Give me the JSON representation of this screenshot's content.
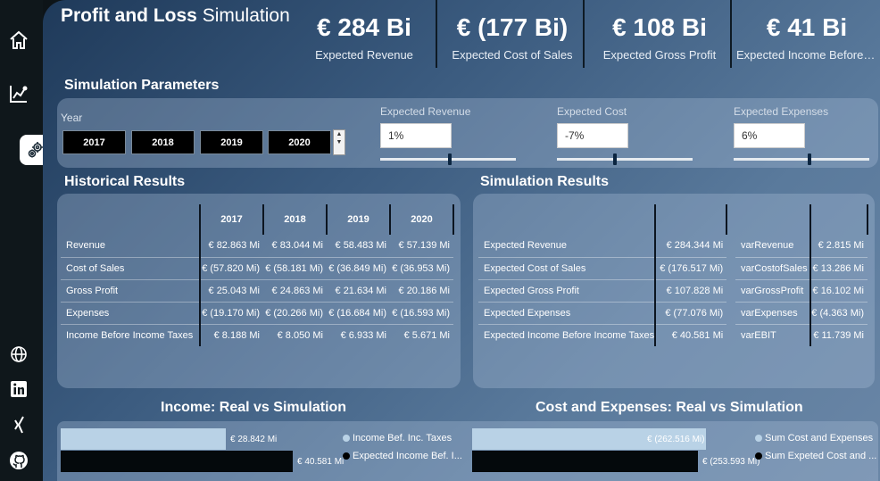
{
  "header": {
    "title_bold": "Profit and Loss",
    "title_light": "Simulation"
  },
  "sidebar": {
    "items": [
      {
        "icon": "home-icon"
      },
      {
        "icon": "line-chart-icon"
      },
      {
        "icon": "gears-icon"
      },
      {
        "icon": "globe-icon"
      },
      {
        "icon": "linkedin-icon"
      },
      {
        "icon": "xing-icon"
      },
      {
        "icon": "github-icon"
      }
    ]
  },
  "kpis": [
    {
      "value": "€ 284 Bi",
      "label": "Expected Revenue"
    },
    {
      "value": "€ (177 Bi)",
      "label": "Expected Cost of Sales"
    },
    {
      "value": "€ 108 Bi",
      "label": "Expected Gross Profit"
    },
    {
      "value": "€ 41 Bi",
      "label": "Expected Income Before Income Taxes"
    }
  ],
  "simulation_parameters": {
    "title": "Simulation Parameters",
    "year_label": "Year",
    "years": [
      "2017",
      "2018",
      "2019",
      "2020"
    ],
    "params": [
      {
        "label": "Expected Revenue",
        "value": "1%",
        "slider_fraction": 0.51
      },
      {
        "label": "Expected Cost",
        "value": "-7%",
        "slider_fraction": 0.43
      },
      {
        "label": "Expected Expenses",
        "value": "6%",
        "slider_fraction": 0.56
      }
    ]
  },
  "historical": {
    "title": "Historical Results",
    "columns": [
      "2017",
      "2018",
      "2019",
      "2020"
    ],
    "rows": [
      {
        "name": "Revenue",
        "values": [
          "€ 82.863 Mi",
          "€ 83.044 Mi",
          "€ 58.483 Mi",
          "€ 57.139 Mi"
        ]
      },
      {
        "name": "Cost of Sales",
        "values": [
          "€ (57.820 Mi)",
          "€ (58.181 Mi)",
          "€ (36.849 Mi)",
          "€ (36.953 Mi)"
        ]
      },
      {
        "name": "Gross Profit",
        "values": [
          "€ 25.043 Mi",
          "€ 24.863 Mi",
          "€ 21.634 Mi",
          "€ 20.186 Mi"
        ]
      },
      {
        "name": "Expenses",
        "values": [
          "€ (19.170 Mi)",
          "€ (20.266 Mi)",
          "€ (16.684 Mi)",
          "€ (16.593 Mi)"
        ]
      },
      {
        "name": "Income Before Income Taxes",
        "values": [
          "€ 8.188 Mi",
          "€ 8.050 Mi",
          "€ 6.933 Mi",
          "€ 5.671 Mi"
        ]
      }
    ]
  },
  "simulation": {
    "title": "Simulation Results",
    "rows": [
      {
        "name": "Expected Revenue",
        "value": "€ 284.344 Mi"
      },
      {
        "name": "Expected Cost of Sales",
        "value": "€ (176.517 Mi)"
      },
      {
        "name": "Expected Gross Profit",
        "value": "€ 107.828 Mi"
      },
      {
        "name": "Expected Expenses",
        "value": "€ (77.076 Mi)"
      },
      {
        "name": "Expected Income Before Income Taxes",
        "value": "€ 40.581 Mi"
      }
    ],
    "var_rows": [
      {
        "name": "varRevenue",
        "value": "€ 2.815 Mi"
      },
      {
        "name": "varCostofSales",
        "value": "€ 13.286 Mi"
      },
      {
        "name": "varGrossProfit",
        "value": "€ 16.102 Mi"
      },
      {
        "name": "varExpenses",
        "value": "€ (4.363 Mi)"
      },
      {
        "name": "varEBIT",
        "value": "€ 11.739 Mi"
      }
    ]
  },
  "chart_data": [
    {
      "type": "bar",
      "title": "Income: Real vs Simulation",
      "categories": [
        "Income Bef. Inc. Taxes",
        "Expected Income Bef. I..."
      ],
      "values": [
        28.842,
        40.581
      ],
      "labels": [
        "€ 28.842 Mi",
        "€ 40.581 Mi"
      ],
      "colors": [
        "#b9d2e6",
        "#04090c"
      ],
      "orientation": "horizontal"
    },
    {
      "type": "bar",
      "title": "Cost and Expenses: Real vs Simulation",
      "categories": [
        "Sum Cost and Expenses",
        "Sum Expeted Cost and ..."
      ],
      "values": [
        262.516,
        253.593
      ],
      "labels": [
        "€ (262.516 Mi)",
        "€ (253.593 Mi)"
      ],
      "colors": [
        "#b9d2e6",
        "#04090c"
      ],
      "orientation": "horizontal"
    }
  ]
}
